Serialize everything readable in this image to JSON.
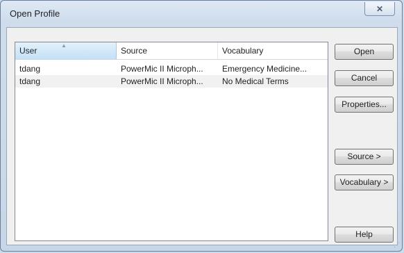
{
  "window": {
    "title": "Open Profile",
    "close_symbol": "✕"
  },
  "table": {
    "columns": [
      "User",
      "Source",
      "Vocabulary"
    ],
    "sort_indicator": "▲",
    "rows": [
      {
        "user": "tdang",
        "source": "PowerMic II Microph...",
        "vocabulary": "Emergency Medicine..."
      },
      {
        "user": "tdang",
        "source": "PowerMic II Microph...",
        "vocabulary": "No Medical Terms"
      }
    ]
  },
  "buttons": {
    "open": "Open",
    "cancel": "Cancel",
    "properties": "Properties...",
    "source": "Source >",
    "vocabulary": "Vocabulary >",
    "help": "Help"
  }
}
